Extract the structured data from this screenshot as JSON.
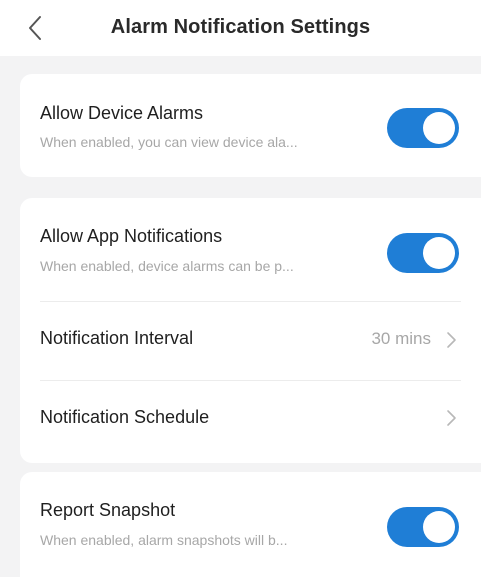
{
  "header": {
    "title": "Alarm Notification Settings",
    "back_icon": "chevron-left-icon"
  },
  "colors": {
    "toggle_on": "#1f7ed6",
    "background": "#f3f3f4",
    "card": "#ffffff",
    "secondary_text": "#a7a7a7"
  },
  "settings": {
    "device_alarms": {
      "title": "Allow Device Alarms",
      "subtitle": "When enabled, you can view device ala...",
      "enabled": true
    },
    "app_notifications": {
      "title": "Allow App Notifications",
      "subtitle": "When enabled, device alarms can be p...",
      "enabled": true
    },
    "notification_interval": {
      "title": "Notification Interval",
      "value": "30 mins"
    },
    "notification_schedule": {
      "title": "Notification Schedule"
    },
    "report_snapshot": {
      "title": "Report Snapshot",
      "subtitle": "When enabled, alarm snapshots will b...",
      "enabled": true
    }
  }
}
